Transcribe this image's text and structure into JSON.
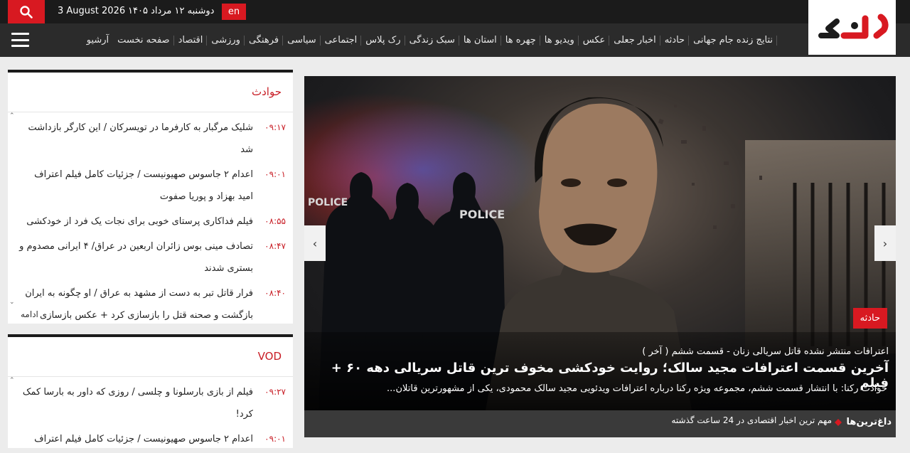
{
  "topbar": {
    "date_en": "3 August 2026",
    "date_fa": "دوشنبه ۱۲ مرداد ۱۴۰۵",
    "lang_label": "en"
  },
  "nav": {
    "items": [
      "آرشیو",
      "صفحه نخست",
      "اقتصاد",
      "ورزشی",
      "فرهنگی",
      "سیاسی",
      "اجتماعی",
      "رک پلاس",
      "سبک زندگی",
      "استان ها",
      "چهره ها",
      "ویدیو ها",
      "عکس",
      "اخبار جعلی",
      "حادثه",
      "نتایج زنده جام جهانی"
    ]
  },
  "sidebar_box1": {
    "title": "حوادث",
    "items": [
      {
        "time": "۰۹:۱۷",
        "title": "شلیک مرگبار به کارفرما در تویسرکان / این کارگر بازداشت شد"
      },
      {
        "time": "۰۹:۰۱",
        "title": "اعدام ۲ جاسوس صهیونیست / جزئیات کامل فیلم اعتراف امید بهزاد و پوریا صفوت"
      },
      {
        "time": "۰۸:۵۵",
        "title": "فیلم فداکاری پرستای خوبی برای نجات یک فرد از خودکشی"
      },
      {
        "time": "۰۸:۴۷",
        "title": "تصادف مینی بوس زائران اربعین در عراق/ ۴ ایرانی مصدوم و بستری شدند"
      },
      {
        "time": "۰۸:۴۰",
        "title": "فرار قاتل تبر به دست از مشهد به عراق / او چگونه به ایران بازگشت و صحنه قتل را بازسازی کرد + عکس بازسازی"
      }
    ],
    "more": "ادامه"
  },
  "sidebar_box2": {
    "title": "VOD",
    "items": [
      {
        "time": "۰۹:۲۷",
        "title": "فیلم از بازی بارسلونا و چلسی / روزی که داور به بارسا کمک کرد!"
      },
      {
        "time": "۰۹:۰۱",
        "title": "اعدام ۲ جاسوس صهیونیست / جزئیات کامل فیلم اعتراف"
      }
    ]
  },
  "hero": {
    "category": "حادثه",
    "supertitle": "اعترافات منتشر نشده قاتل سریالی زنان - قسمت ششم ( آخر )",
    "headline": "آخرین قسمت اعترافات مجید سالک؛ روایت خودکشی مخوف ترین قاتل سریالی دهه ۶۰ + فیلم",
    "lead": "حوادث رکنا: با انتشار قسمت ششم، مجموعه ویژه رکنا درباره اعترافات ویدئویی مجید سالک محمودی، یکی از مشهورترین قاتلان...",
    "police_label_1": "POLICE",
    "police_label_2": "POLICE"
  },
  "hot": {
    "title": "داغ‌ترین‌ها",
    "text": "مهم ترین اخبار اقتصادی در 24 ساعت گذشته"
  },
  "colors": {
    "brand_red": "#d81921",
    "dark": "#1b1b1b",
    "nav_bg": "#2b2b2b"
  }
}
